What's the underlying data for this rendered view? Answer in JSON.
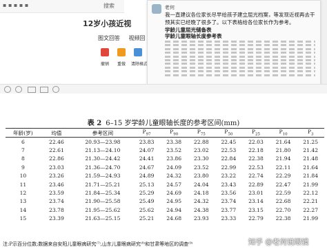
{
  "background": {
    "tab_label": "搜索",
    "heading": "12岁小孩近视",
    "tabs": [
      "图文回答",
      "视频回"
    ],
    "tools": [
      {
        "label": "撤销",
        "color": "#e0463a"
      },
      {
        "label": "重做",
        "color": "#f09a22"
      },
      {
        "label": "清除格式",
        "color": "#4a90d9"
      }
    ]
  },
  "message": {
    "sender": "老何",
    "text": "我一直建议各位家长尽早给孩子建立屈光档案，等发现近视再去干预其实已经晚了很多了。以下表格给各位家长作为参考。",
    "line1": "学龄儿童屈光储备表",
    "line2": "学龄儿童眼轴长度参考表"
  },
  "table": {
    "caption_num": "表 2",
    "caption_text": "6–15 岁学龄儿童眼轴长度的参考区间(mm)",
    "headers": [
      "年龄(岁)",
      "均值",
      "参考区间",
      "P",
      "P",
      "P",
      "P",
      "P",
      "P",
      "P"
    ],
    "header_subs": [
      "",
      "",
      "",
      "97",
      "90",
      "75",
      "50",
      "25",
      "10",
      "3"
    ],
    "rows": [
      [
        "6",
        "22.46",
        "20.93—23.98",
        "23.83",
        "23.38",
        "22.88",
        "22.45",
        "22.03",
        "21.64",
        "21.25"
      ],
      [
        "7",
        "22.61",
        "21.13—24.10",
        "24.07",
        "23.52",
        "23.02",
        "22.53",
        "22.18",
        "21.80",
        "21.42"
      ],
      [
        "8",
        "22.86",
        "21.30—24.42",
        "24.41",
        "23.86",
        "23.30",
        "22.84",
        "22.38",
        "21.94",
        "21.48"
      ],
      [
        "9",
        "23.03",
        "21.36—24.70",
        "24.67",
        "24.09",
        "23.52",
        "22.99",
        "22.53",
        "22.11",
        "21.64"
      ],
      [
        "10",
        "23.26",
        "21.59—24.93",
        "24.89",
        "24.32",
        "23.80",
        "23.22",
        "22.74",
        "22.29",
        "21.84"
      ],
      [
        "11",
        "23.46",
        "21.71—25.21",
        "25.13",
        "24.57",
        "24.04",
        "23.43",
        "22.89",
        "22.47",
        "21.99"
      ],
      [
        "12",
        "23.59",
        "21.84—25.34",
        "25.29",
        "24.69",
        "24.18",
        "23.56",
        "23.01",
        "22.59",
        "22.12"
      ],
      [
        "13",
        "23.74",
        "21.90—25.58",
        "25.49",
        "24.95",
        "24.32",
        "23.74",
        "23.14",
        "22.68",
        "22.21"
      ],
      [
        "14",
        "23.78",
        "21.95—25.62",
        "25.62",
        "24.94",
        "24.38",
        "23.77",
        "23.15",
        "22.70",
        "22.27"
      ],
      [
        "15",
        "23.39",
        "21.63—25.15",
        "25.21",
        "24.68",
        "23.93",
        "23.33",
        "22.79",
        "22.38",
        "21.99"
      ]
    ],
    "note": "注:P示百分位数;数据来自安阳儿童眼病研究⁽⁷⁾,山东儿童眼病研究⁽⁸⁾和甘肃等地区的调查⁽⁹⁾",
    "watermark": "知乎 @老何说眼镜"
  }
}
